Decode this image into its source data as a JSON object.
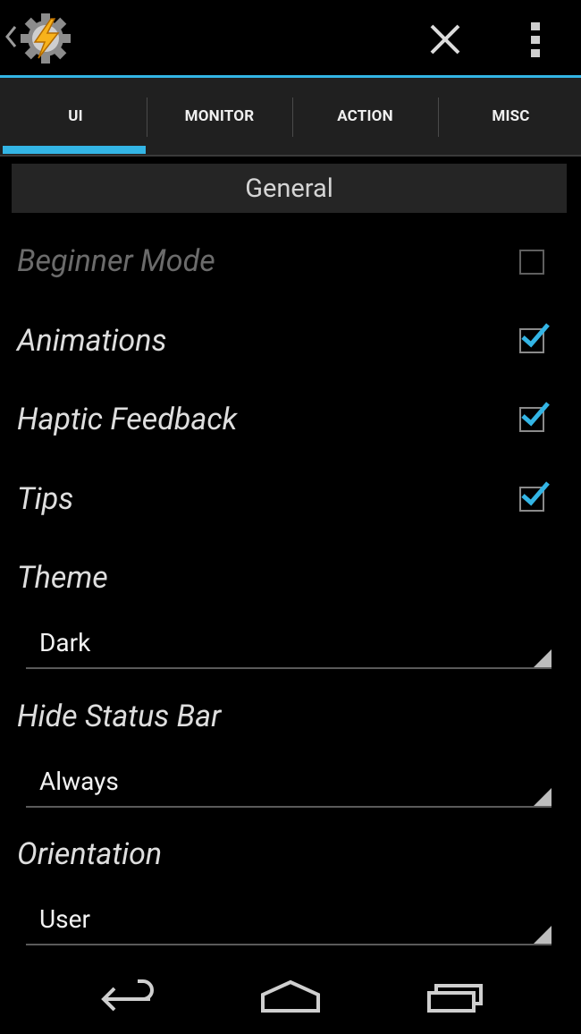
{
  "app": {
    "logo_icon": "tasker-bolt-gear-icon",
    "accent": "#33b5e5",
    "logo_bolt_color": "#f7b21b"
  },
  "actionbar": {
    "back_icon": "chevron-left-icon",
    "close_icon": "close-icon",
    "overflow_icon": "overflow-menu-icon"
  },
  "tabs": [
    {
      "label": "UI",
      "selected": true
    },
    {
      "label": "MONITOR",
      "selected": false
    },
    {
      "label": "ACTION",
      "selected": false
    },
    {
      "label": "MISC",
      "selected": false
    }
  ],
  "section": {
    "title": "General"
  },
  "prefs": {
    "beginner_mode": {
      "label": "Beginner Mode",
      "checked": false,
      "enabled": false
    },
    "animations": {
      "label": "Animations",
      "checked": true
    },
    "haptic_feedback": {
      "label": "Haptic Feedback",
      "checked": true
    },
    "tips": {
      "label": "Tips",
      "checked": true
    },
    "theme": {
      "label": "Theme",
      "value": "Dark"
    },
    "hide_status_bar": {
      "label": "Hide Status Bar",
      "value": "Always"
    },
    "orientation": {
      "label": "Orientation",
      "value": "User"
    }
  },
  "navbar": {
    "back_icon": "nav-back-icon",
    "home_icon": "nav-home-icon",
    "recents_icon": "nav-recents-icon"
  }
}
